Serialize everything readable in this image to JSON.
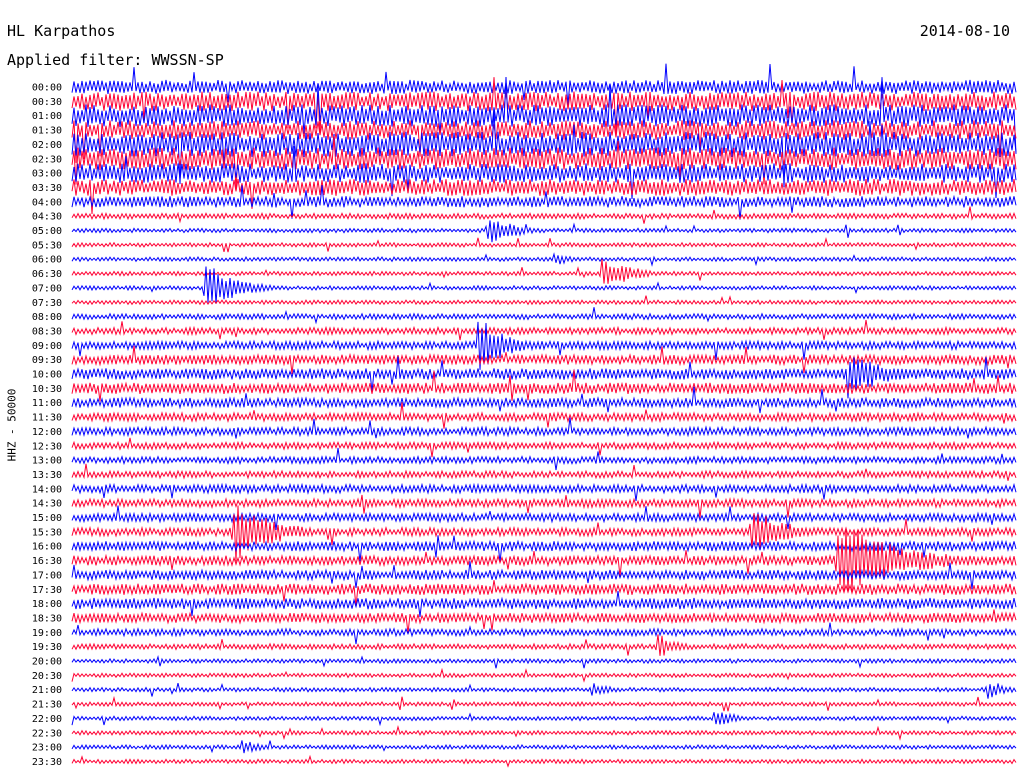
{
  "header": {
    "station": "HL Karpathos",
    "date": "2014-08-10",
    "filter": "Applied filter: WWSSN-SP"
  },
  "chart_data": {
    "type": "line",
    "title": "HL Karpathos",
    "date": "2014-08-10",
    "ylabel": "HHZ - 50000",
    "row_labels": [
      "00:00",
      "00:30",
      "01:00",
      "01:30",
      "02:00",
      "02:30",
      "03:00",
      "03:30",
      "04:00",
      "04:30",
      "05:00",
      "05:30",
      "06:00",
      "06:30",
      "07:00",
      "07:30",
      "08:00",
      "08:30",
      "09:00",
      "09:30",
      "10:00",
      "10:30",
      "11:00",
      "11:30",
      "12:00",
      "12:30",
      "13:00",
      "13:30",
      "14:00",
      "14:30",
      "15:00",
      "15:30",
      "16:00",
      "16:30",
      "17:00",
      "17:30",
      "18:00",
      "18:30",
      "19:00",
      "19:30",
      "20:00",
      "20:30",
      "21:00",
      "21:30",
      "22:00",
      "22:30",
      "23:00",
      "23:30"
    ],
    "series_colors": [
      "#0000ff",
      "#ff0033"
    ],
    "row_noise": [
      5,
      7,
      8,
      7,
      9,
      8,
      7,
      6,
      4,
      2,
      1.5,
      1.5,
      1.5,
      1.5,
      1.5,
      1.5,
      2,
      2.5,
      3,
      3.5,
      4,
      4,
      3.5,
      3,
      3,
      2.5,
      2.5,
      2.5,
      3,
      3,
      3,
      3,
      3.5,
      3.5,
      3.5,
      4,
      4,
      3.5,
      2.5,
      2,
      1.5,
      1.5,
      1.5,
      1.5,
      1.5,
      1.5,
      1.5,
      1.5
    ],
    "events": [
      {
        "row": 4,
        "time": 0.05,
        "amp": 10,
        "dur": 0.03
      },
      {
        "row": 10,
        "time": 0.44,
        "amp": 15,
        "dur": 0.03
      },
      {
        "row": 12,
        "time": 0.51,
        "amp": 7,
        "dur": 0.02
      },
      {
        "row": 13,
        "time": 0.56,
        "amp": 16,
        "dur": 0.02
      },
      {
        "row": 13,
        "time": 0.58,
        "amp": 14,
        "dur": 0.02
      },
      {
        "row": 14,
        "time": 0.14,
        "amp": 28,
        "dur": 0.03
      },
      {
        "row": 18,
        "time": 0.43,
        "amp": 30,
        "dur": 0.03
      },
      {
        "row": 20,
        "time": 0.82,
        "amp": 26,
        "dur": 0.04
      },
      {
        "row": 31,
        "time": 0.17,
        "amp": 34,
        "dur": 0.04
      },
      {
        "row": 31,
        "time": 0.72,
        "amp": 28,
        "dur": 0.03
      },
      {
        "row": 33,
        "time": 0.81,
        "amp": 45,
        "dur": 0.06
      },
      {
        "row": 39,
        "time": 0.62,
        "amp": 14,
        "dur": 0.02
      },
      {
        "row": 42,
        "time": 0.55,
        "amp": 8,
        "dur": 0.02
      },
      {
        "row": 42,
        "time": 0.97,
        "amp": 10,
        "dur": 0.02
      },
      {
        "row": 44,
        "time": 0.68,
        "amp": 11,
        "dur": 0.02
      },
      {
        "row": 46,
        "time": 0.18,
        "amp": 8,
        "dur": 0.02
      }
    ]
  }
}
